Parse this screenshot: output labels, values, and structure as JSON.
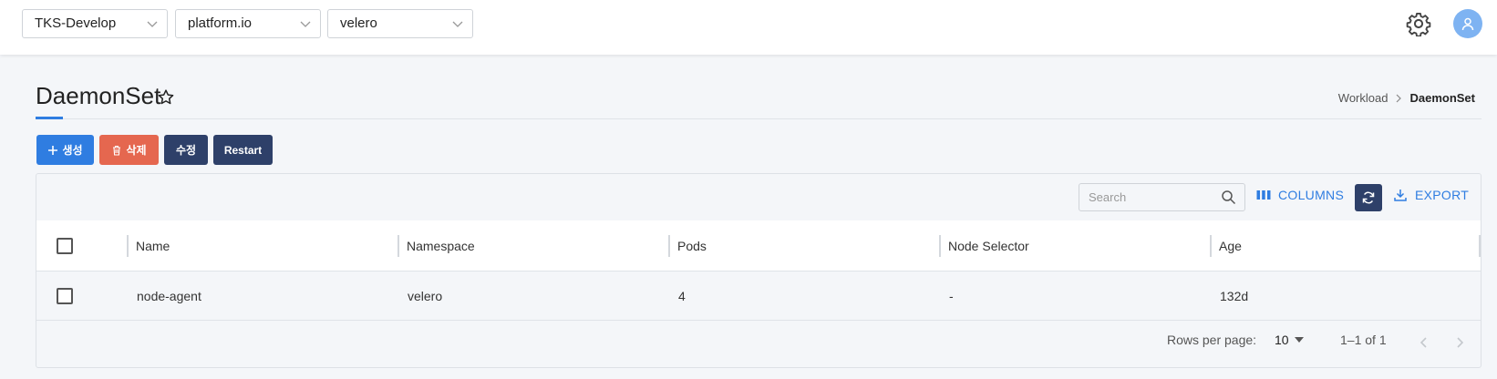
{
  "header": {
    "cluster": "TKS-Develop",
    "project": "platform.io",
    "namespace": "velero",
    "settings_icon": "gear-icon",
    "avatar_icon": "user-icon"
  },
  "page": {
    "title": "DaemonSet",
    "breadcrumb": [
      "Workload",
      "DaemonSet"
    ]
  },
  "actions": {
    "create": "생성",
    "delete": "삭제",
    "edit": "수정",
    "restart": "Restart"
  },
  "toolbar": {
    "search_placeholder": "Search",
    "columns": "COLUMNS",
    "export": "EXPORT"
  },
  "table": {
    "columns": [
      "Name",
      "Namespace",
      "Pods",
      "Node Selector",
      "Age"
    ],
    "rows": [
      {
        "name": "node-agent",
        "namespace": "velero",
        "pods": "4",
        "node_selector": "-",
        "age": "132d"
      }
    ]
  },
  "pagination": {
    "rows_per_page_label": "Rows per page:",
    "rows_per_page": "10",
    "range": "1–1 of 1"
  },
  "colors": {
    "primary": "#2f7de1",
    "danger": "#e5674f",
    "dark": "#2e4069",
    "avatar": "#7eb3f2"
  }
}
